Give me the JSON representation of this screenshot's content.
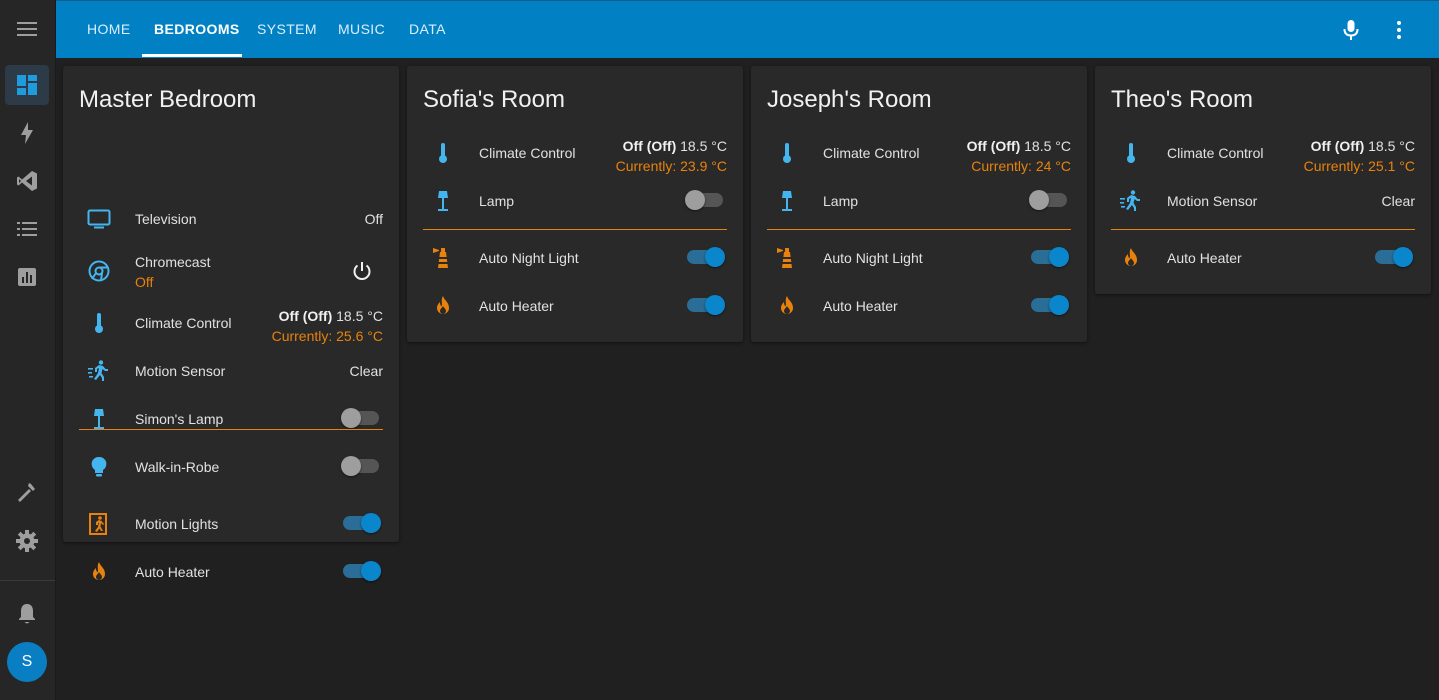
{
  "colors": {
    "header": "#0181c4",
    "accent_orange": "#e8820c",
    "icon_blue": "#44b5ef",
    "toggle_on": "#0a86cd"
  },
  "sidebar": {
    "items": [
      {
        "icon": "menu-icon"
      },
      {
        "icon": "dashboard-icon",
        "active": true
      },
      {
        "icon": "lightning-icon"
      },
      {
        "icon": "vscode-icon"
      },
      {
        "icon": "list-icon"
      },
      {
        "icon": "chart-icon"
      },
      {
        "icon": "hammer-icon"
      },
      {
        "icon": "gear-icon"
      },
      {
        "icon": "bell-icon"
      }
    ],
    "avatar_initial": "S"
  },
  "header": {
    "tabs": [
      {
        "label": "HOME"
      },
      {
        "label": "BEDROOMS",
        "active": true
      },
      {
        "label": "SYSTEM"
      },
      {
        "label": "MUSIC"
      },
      {
        "label": "DATA"
      }
    ],
    "icons": [
      "microphone-icon",
      "more-vert-icon"
    ]
  },
  "cards": [
    {
      "title": "Master Bedroom",
      "rows": [
        {
          "label": "Television",
          "state": "Off"
        },
        {
          "label": "Chromecast",
          "sub": "Off"
        },
        {
          "label": "Climate Control",
          "mode": "Off (Off)",
          "target": "18.5 °C",
          "current": "Currently: 25.6 °C"
        },
        {
          "label": "Motion Sensor",
          "state": "Clear"
        },
        {
          "label": "Simon's Lamp",
          "on": false
        },
        {
          "label": "Walk-in-Robe",
          "on": false
        },
        {
          "label": "Motion Lights",
          "on": true
        },
        {
          "label": "Auto Heater",
          "on": true
        }
      ]
    },
    {
      "title": "Sofia's Room",
      "rows": [
        {
          "label": "Climate Control",
          "mode": "Off (Off)",
          "target": "18.5 °C",
          "current": "Currently: 23.9 °C"
        },
        {
          "label": "Lamp",
          "on": false
        },
        {
          "label": "Auto Night Light",
          "on": true
        },
        {
          "label": "Auto Heater",
          "on": true
        }
      ]
    },
    {
      "title": "Joseph's Room",
      "rows": [
        {
          "label": "Climate Control",
          "mode": "Off (Off)",
          "target": "18.5 °C",
          "current": "Currently: 24 °C"
        },
        {
          "label": "Lamp",
          "on": false
        },
        {
          "label": "Auto Night Light",
          "on": true
        },
        {
          "label": "Auto Heater",
          "on": true
        }
      ]
    },
    {
      "title": "Theo's Room",
      "rows": [
        {
          "label": "Climate Control",
          "mode": "Off (Off)",
          "target": "18.5 °C",
          "current": "Currently: 25.1 °C"
        },
        {
          "label": "Motion Sensor",
          "state": "Clear"
        },
        {
          "label": "Auto Heater",
          "on": true
        }
      ]
    }
  ]
}
